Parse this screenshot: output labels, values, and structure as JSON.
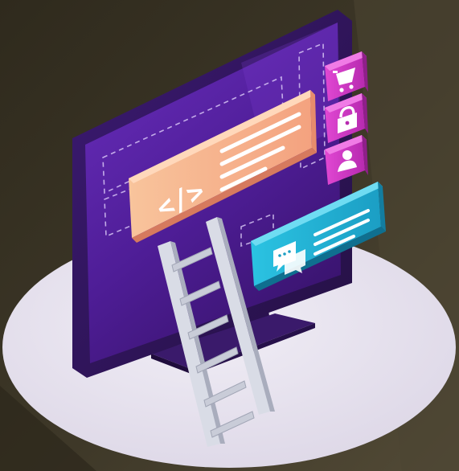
{
  "illustration": {
    "code_card": {
      "glyph": "</>"
    },
    "side_icons": [
      "cart-icon",
      "lock-icon",
      "user-icon"
    ],
    "chat_card": {
      "icon": "chat-icon"
    },
    "colors": {
      "background": "#3b3526",
      "platform": "#e8e4ef",
      "monitor_screen": "#5a22a8",
      "code_card": "#f7b08f",
      "side_tabs": "#d23bc4",
      "chat_card": "#23b6d6",
      "ladder": "#d9dce6"
    }
  }
}
